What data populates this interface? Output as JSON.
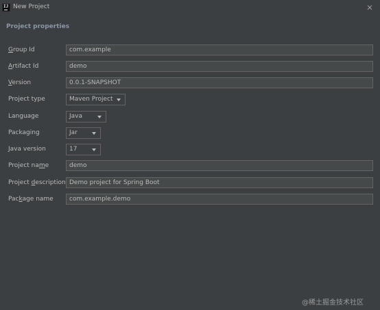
{
  "window": {
    "title": "New Project",
    "app_icon_text": "IJ"
  },
  "section": {
    "title": "Project properties"
  },
  "fields": {
    "group_id": {
      "label_mnemonic": "G",
      "label_rest": "roup Id",
      "value": "com.example"
    },
    "artifact_id": {
      "label_mnemonic": "A",
      "label_rest": "rtifact Id",
      "value": "demo"
    },
    "version": {
      "label_mnemonic": "V",
      "label_rest": "ersion",
      "value": "0.0.1-SNAPSHOT"
    },
    "project_type": {
      "label": "Project type",
      "value": "Maven Project"
    },
    "language": {
      "label": "Language",
      "value": "Java"
    },
    "packaging": {
      "label": "Packaging",
      "value": "Jar"
    },
    "java_version": {
      "label": "Java version",
      "value": "17"
    },
    "project_name": {
      "label_before": "Project na",
      "label_mnemonic": "m",
      "label_after": "e",
      "value": "demo"
    },
    "project_description": {
      "label_before": "Project ",
      "label_mnemonic": "d",
      "label_after": "escription",
      "value": "Demo project for Spring Boot"
    },
    "package_name": {
      "label_before": "Pac",
      "label_mnemonic": "k",
      "label_after": "age name",
      "value": "com.example.demo"
    }
  },
  "watermark": "@稀土掘金技术社区",
  "colors": {
    "background": "#3c3f41",
    "field_background": "#45494a",
    "field_border": "#646464",
    "text": "#bbbbbb",
    "section_title": "#8c96a3"
  }
}
